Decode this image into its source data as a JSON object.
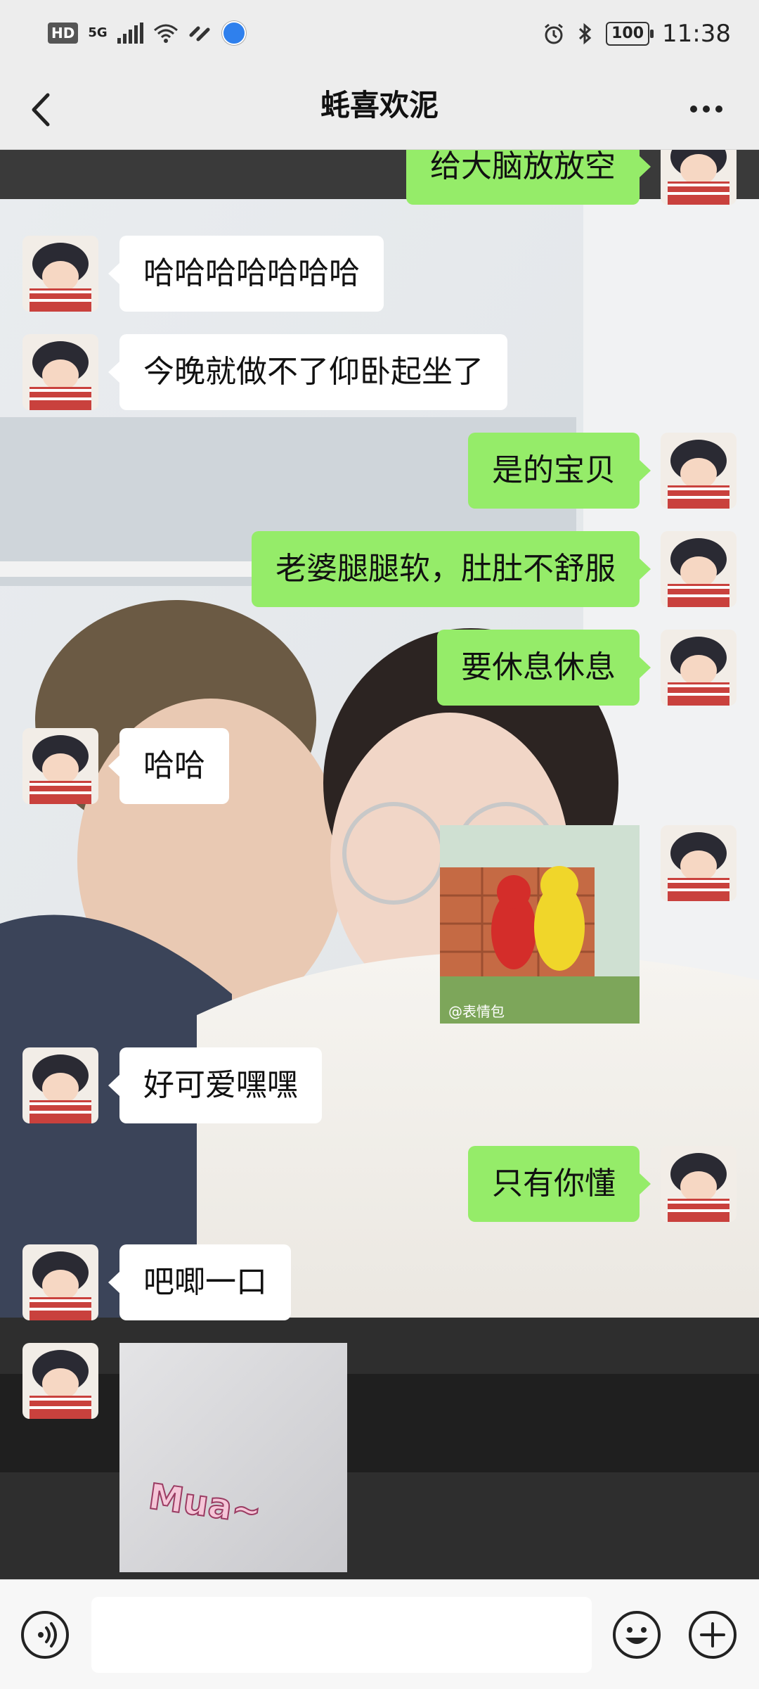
{
  "status_bar": {
    "hd": "HD",
    "network": "5G",
    "battery": "100",
    "time": "11:38",
    "icons": [
      "signal-icon",
      "wifi-icon",
      "link-icon",
      "globe-icon",
      "alarm-icon",
      "bluetooth-icon",
      "battery-icon"
    ]
  },
  "header": {
    "title": "蚝喜欢泥",
    "back_icon": "chevron-left-icon",
    "more_icon": "more-dots-icon"
  },
  "messages": [
    {
      "side": "out",
      "text": "给大脑放放空"
    },
    {
      "side": "in",
      "text": "哈哈哈哈哈哈哈"
    },
    {
      "side": "in",
      "text": "今晚就做不了仰卧起坐了"
    },
    {
      "side": "out",
      "text": "是的宝贝"
    },
    {
      "side": "out",
      "text": "老婆腿腿软，肚肚不舒服"
    },
    {
      "side": "out",
      "text": "要休息休息"
    },
    {
      "side": "in",
      "text": "哈哈"
    },
    {
      "side": "out",
      "type": "sticker",
      "watermark": "@表情包"
    },
    {
      "side": "in",
      "text": "好可爱嘿嘿"
    },
    {
      "side": "out",
      "text": "只有你懂"
    },
    {
      "side": "in",
      "text": "吧唧一口"
    },
    {
      "side": "in",
      "type": "sticker",
      "caption": "Mua~"
    }
  ],
  "input_bar": {
    "placeholder": "",
    "voice_icon": "voice-icon",
    "emoji_icon": "emoji-icon",
    "plus_icon": "plus-icon"
  },
  "colors": {
    "outgoing_bubble": "#95ec69",
    "incoming_bubble": "#ffffff",
    "bar_background": "#ededed"
  }
}
